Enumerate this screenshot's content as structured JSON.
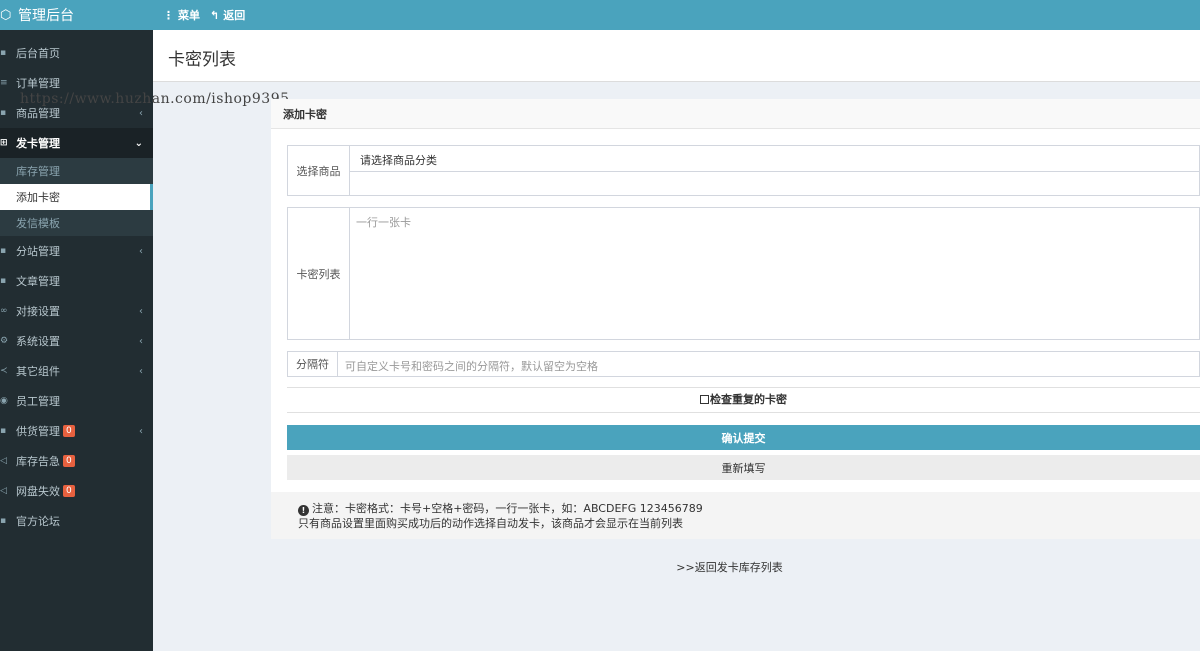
{
  "brand": {
    "title": "管理后台"
  },
  "topbar": {
    "menu_label": "菜单",
    "back_label": "返回"
  },
  "watermark": "https://www.huzhan.com/ishop9395",
  "sidebar": {
    "items": [
      {
        "label": "后台首页",
        "icon": "dashboard-icon"
      },
      {
        "label": "订单管理",
        "icon": "list-icon"
      },
      {
        "label": "商品管理",
        "icon": "cart-icon",
        "arrow": "‹"
      },
      {
        "label": "发卡管理",
        "icon": "grid-icon",
        "arrow": "⌄"
      }
    ],
    "sub_items": [
      {
        "label": "库存管理"
      },
      {
        "label": "添加卡密"
      },
      {
        "label": "发信模板"
      }
    ],
    "items_after": [
      {
        "label": "分站管理",
        "icon": "sitemap-icon",
        "arrow": "‹"
      },
      {
        "label": "文章管理",
        "icon": "file-icon"
      },
      {
        "label": "对接设置",
        "icon": "link-icon",
        "arrow": "‹"
      },
      {
        "label": "系统设置",
        "icon": "gear-icon",
        "arrow": "‹"
      },
      {
        "label": "其它组件",
        "icon": "share-icon",
        "arrow": "‹"
      },
      {
        "label": "员工管理",
        "icon": "user-icon"
      },
      {
        "label": "供货管理",
        "icon": "truck-icon",
        "badge": "0",
        "arrow": "‹"
      },
      {
        "label": "库存告急",
        "icon": "bell-icon",
        "badge": "0"
      },
      {
        "label": "网盘失效",
        "icon": "cloud-icon",
        "badge": "0"
      },
      {
        "label": "官方论坛",
        "icon": "forum-icon"
      }
    ]
  },
  "page": {
    "title": "卡密列表"
  },
  "card": {
    "header": "添加卡密",
    "select_label": "选择商品",
    "select_value": "请选择商品分类",
    "cards_label": "卡密列表",
    "cards_placeholder": "一行一张卡",
    "separator_label": "分隔符",
    "separator_placeholder": "可自定义卡号和密码之间的分隔符，默认留空为空格",
    "check_label": "检查重复的卡密",
    "submit_label": "确认提交",
    "reset_label": "重新填写",
    "note_line1": "注意：卡密格式：卡号+空格+密码，一行一张卡，如：ABCDEFG 123456789",
    "note_line2": "只有商品设置里面购买成功后的动作选择自动发卡，该商品才会显示在当前列表"
  },
  "back_link": ">>返回发卡库存列表",
  "colors": {
    "accent": "#4aa3bd",
    "sidebar_bg": "#222d32",
    "badge": "#e8613f"
  }
}
